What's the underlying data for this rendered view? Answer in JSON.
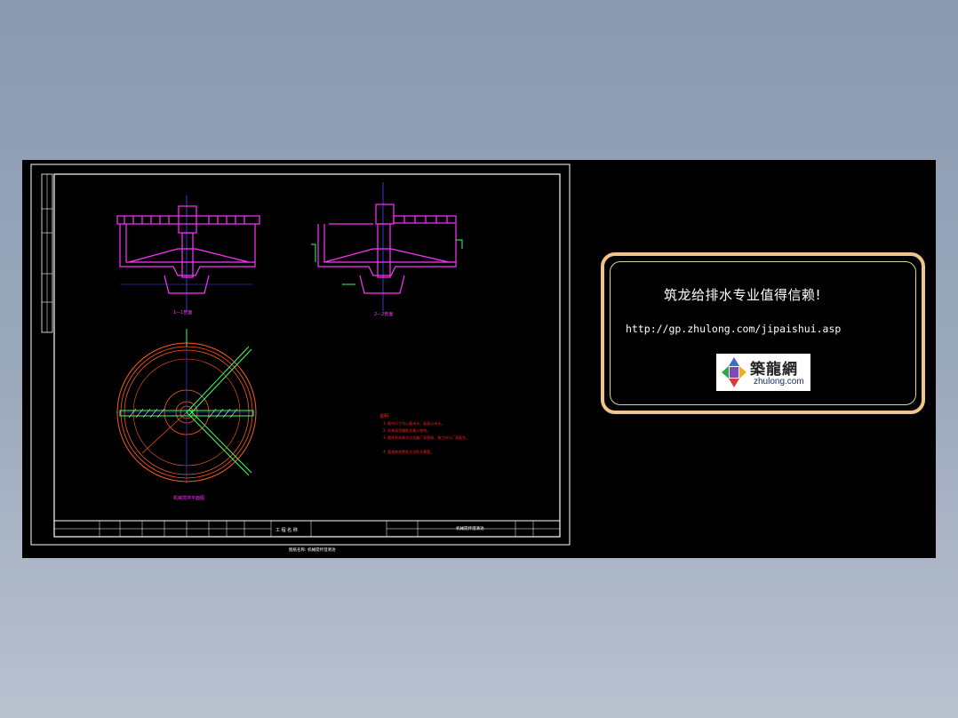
{
  "drawing": {
    "section1_label": "1—1剖面",
    "section2_label": "2—2剖面",
    "plan_label": "机械搅拌平面图",
    "notes_title": "说明",
    "notes": [
      "1. 图中尺寸均以毫米计，标高以米计。",
      "2. 池体采用钢筋混凝土结构。",
      "3. 搅拌机安装详见设备厂家图纸，施工时与厂家配合。",
      "4. 管道穿池壁处均设防水套管。"
    ],
    "title_block_text": "工 程 名 称",
    "drawing_title": "机械搅拌澄清池",
    "sheet_caption": "图纸名称: 机械搅拌澄清池"
  },
  "promo": {
    "title": "筑龙给排水专业值得信赖!",
    "url": "http://gp.zhulong.com/jipaishui.asp",
    "logo_cn": "築龍網",
    "logo_en": "zhulong.com"
  },
  "colors": {
    "background": "#000000",
    "frame": "#ffffff",
    "structure": "#ff33ff",
    "plan_ring": "#ff5a1e",
    "axis": "#4a4aff",
    "pipe": "#3cff6a",
    "notes": "#ff2020",
    "promo_border": "#f0c48c"
  }
}
